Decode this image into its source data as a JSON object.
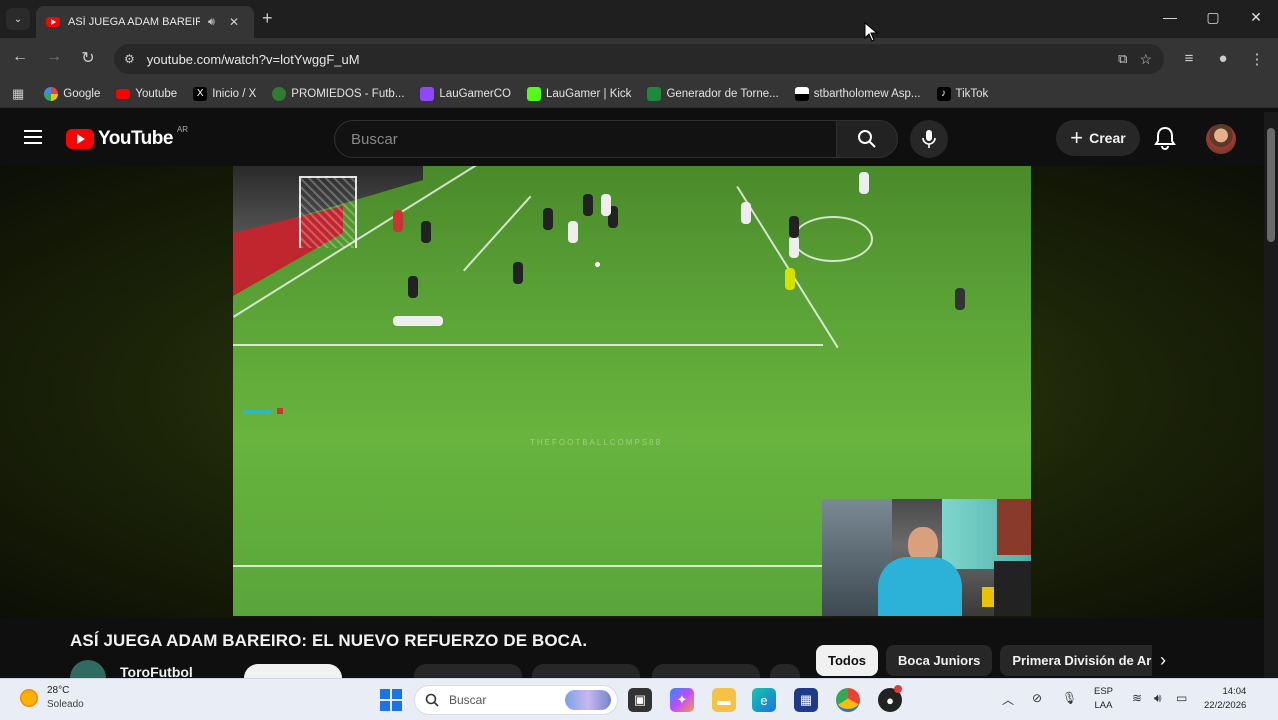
{
  "browser": {
    "tab": {
      "title": "ASÍ JUEGA ADAM BAREIRO",
      "audio_icon": "speaker-icon"
    },
    "new_tab_label": "+",
    "window_controls": [
      "—",
      "▢",
      "✕"
    ],
    "url": "youtube.com/watch?v=lotYwggF_uM",
    "bookmarks": [
      {
        "label": "Google",
        "color": "#4285f4"
      },
      {
        "label": "Youtube",
        "color": "#ff0000"
      },
      {
        "label": "Inicio / X",
        "color": "#000000"
      },
      {
        "label": "PROMIEDOS - Futb...",
        "color": "#2e7d32"
      },
      {
        "label": "LauGamerCO",
        "color": "#9146ff"
      },
      {
        "label": "LauGamer | Kick",
        "color": "#53fc18"
      },
      {
        "label": "Generador de Torne...",
        "color": "#1b8a3a"
      },
      {
        "label": "stbartholomew Asp...",
        "color": "#ffffff"
      },
      {
        "label": "TikTok",
        "color": "#010101"
      }
    ]
  },
  "youtube": {
    "logo_text": "YouTube",
    "country_code": "AR",
    "search_placeholder": "Buscar",
    "create_label": "Crear",
    "video": {
      "watermark": "THEFOOTBALLCOMPS88",
      "title": "ASÍ JUEGA ADAM BAREIRO: EL NUEVO REFUERZO DE BOCA.",
      "channel": "ToroFutbol"
    },
    "chips": [
      {
        "label": "Todos",
        "active": true
      },
      {
        "label": "Boca Juniors",
        "active": false
      },
      {
        "label": "Primera División de Argentina",
        "active": false
      }
    ]
  },
  "taskbar": {
    "weather": {
      "temp": "28°C",
      "desc": "Soleado"
    },
    "search_label": "Buscar",
    "lang": "ESP",
    "layout": "LAA",
    "time": "14:04",
    "date": "22/2/2026"
  },
  "colors": {
    "accent": "#ff0000",
    "background": "#0f0f0f",
    "taskbar": "#e9eef6"
  }
}
